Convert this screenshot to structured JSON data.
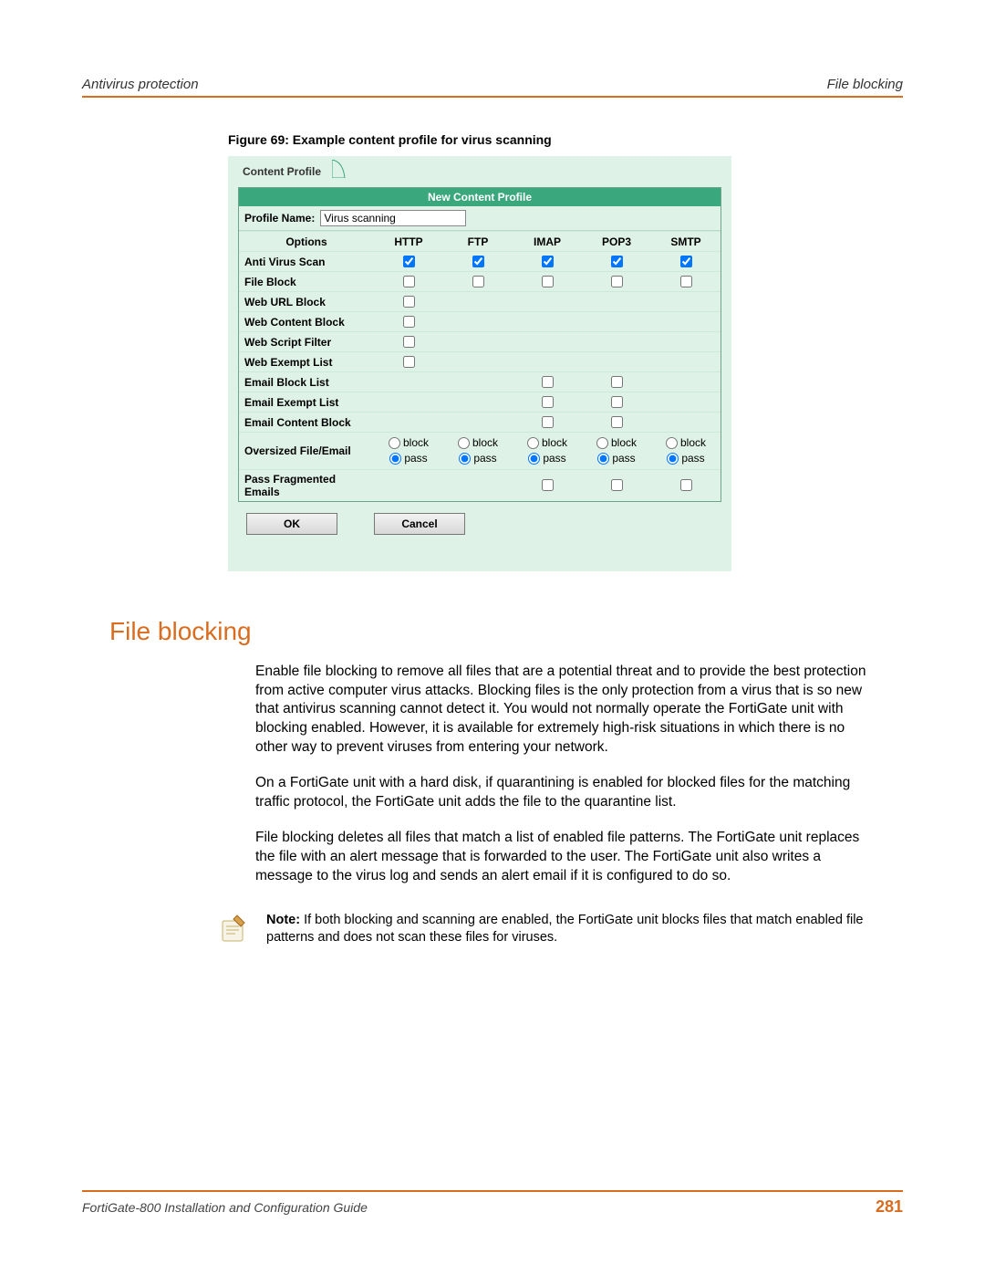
{
  "header": {
    "left": "Antivirus protection",
    "right": "File blocking"
  },
  "figureCaption": "Figure 69: Example content profile for virus scanning",
  "tabLabel": "Content Profile",
  "panelTitle": "New Content Profile",
  "profileNameLabel": "Profile Name:",
  "profileNameValue": "Virus scanning",
  "cols": {
    "options": "Options",
    "http": "HTTP",
    "ftp": "FTP",
    "imap": "IMAP",
    "pop3": "POP3",
    "smtp": "SMTP"
  },
  "rows": {
    "avscan": "Anti Virus Scan",
    "fileblock": "File Block",
    "weburl": "Web URL Block",
    "webcontent": "Web Content Block",
    "webscript": "Web Script Filter",
    "webexempt": "Web Exempt List",
    "emailblock": "Email Block List",
    "emailexempt": "Email Exempt List",
    "emailcontent": "Email Content Block",
    "oversize": "Oversized File/Email",
    "passfrag": "Pass Fragmented Emails"
  },
  "oversizeLabels": {
    "block": "block",
    "pass": "pass"
  },
  "buttons": {
    "ok": "OK",
    "cancel": "Cancel"
  },
  "sectionHeading": "File blocking",
  "paragraphs": {
    "p1": "Enable file blocking to remove all files that are a potential threat and to provide the best protection from active computer virus attacks. Blocking files is the only protection from a virus that is so new that antivirus scanning cannot detect it. You would not normally operate the FortiGate unit with blocking enabled. However, it is available for extremely high-risk situations in which there is no other way to prevent viruses from entering your network.",
    "p2": "On a FortiGate unit with a hard disk, if quarantining is enabled for blocked files for the matching traffic protocol, the FortiGate unit adds the file to the quarantine list.",
    "p3": "File blocking deletes all files that match a list of enabled file patterns. The FortiGate unit replaces the file with an alert message that is forwarded to the user. The FortiGate unit also writes a message to the virus log and sends an alert email if it is configured to do so."
  },
  "note": {
    "label": "Note:",
    "text": " If both blocking and scanning are enabled, the FortiGate unit blocks files that match enabled file patterns and does not scan these files for viruses."
  },
  "footer": {
    "left": "FortiGate-800 Installation and Configuration Guide",
    "page": "281"
  }
}
